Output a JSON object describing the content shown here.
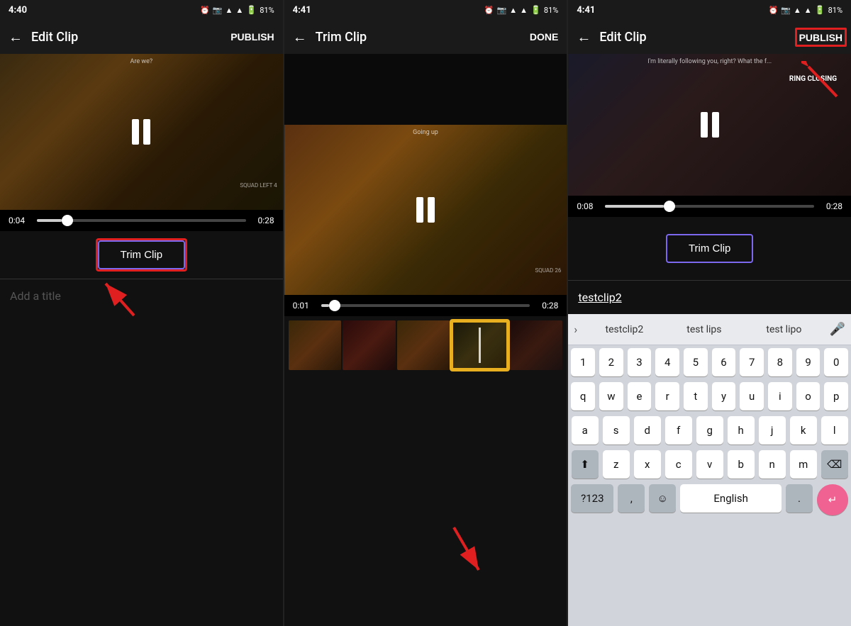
{
  "panels": [
    {
      "id": "panel1",
      "status_time": "4:40",
      "status_battery": "81%",
      "top_bar_title": "Edit Clip",
      "back_label": "←",
      "action_btn": "PUBLISH",
      "video_time_current": "0:04",
      "video_time_total": "0:28",
      "scrubber_pct": 12,
      "trim_clip_label": "Trim Clip",
      "add_title_placeholder": "Add a title"
    },
    {
      "id": "panel2",
      "status_time": "4:41",
      "status_battery": "81%",
      "top_bar_title": "Trim Clip",
      "back_label": "←",
      "action_btn": "DONE",
      "video_time_current": "0:01",
      "video_time_total": "0:28",
      "scrubber_pct": 4
    },
    {
      "id": "panel3",
      "status_time": "4:41",
      "status_battery": "81%",
      "top_bar_title": "Edit Clip",
      "back_label": "←",
      "action_btn": "PUBLISH",
      "video_time_current": "0:08",
      "video_time_total": "0:28",
      "scrubber_pct": 28,
      "trim_clip_label": "Trim Clip",
      "title_value": "testclip2",
      "keyboard": {
        "suggestions": [
          "testclip2",
          "test lips",
          "test lipo"
        ],
        "row1": [
          "1",
          "2",
          "3",
          "4",
          "5",
          "6",
          "7",
          "8",
          "9",
          "0"
        ],
        "row2": [
          "q",
          "w",
          "e",
          "r",
          "t",
          "y",
          "u",
          "i",
          "o",
          "p"
        ],
        "row3": [
          "a",
          "s",
          "d",
          "f",
          "g",
          "h",
          "j",
          "k",
          "l"
        ],
        "row4": [
          "z",
          "x",
          "c",
          "v",
          "b",
          "n",
          "m"
        ],
        "special_left": "?123",
        "special_mid": "English",
        "special_right": "."
      }
    }
  ]
}
